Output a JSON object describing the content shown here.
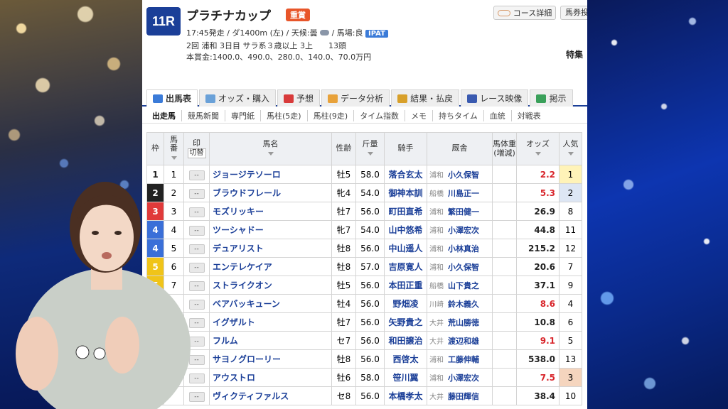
{
  "race": {
    "number": "11R",
    "name": "プラチナカップ",
    "grade": "重賞",
    "line1": "17:45発走 / ダ1400m (左) / 天候:曇",
    "line1_tail": "/ 馬場:良",
    "ipat": "IPAT",
    "line2": "2回 浦和 3日目 サラ系３歳以上 3上　　13頭",
    "line3": "本賞金:1400.0、490.0、280.0、140.0、70.0万円",
    "course_button": "コース詳細",
    "bet_button": "馬券投",
    "special": "特集"
  },
  "tabs": [
    {
      "label": "出馬表",
      "icon": "table-icon",
      "color": "#3b7bd8"
    },
    {
      "label": "オッズ・購入",
      "icon": "odds-icon",
      "color": "#6aa1d8"
    },
    {
      "label": "予想",
      "icon": "target-icon",
      "color": "#d83a3a"
    },
    {
      "label": "データ分析",
      "icon": "chart-icon",
      "color": "#e8a23a"
    },
    {
      "label": "結果・払戻",
      "icon": "coins-icon",
      "color": "#d8a02a"
    },
    {
      "label": "レース映像",
      "icon": "video-icon",
      "color": "#3a5ab0"
    },
    {
      "label": "掲示",
      "icon": "board-icon",
      "color": "#3aa05a"
    }
  ],
  "subtabs": [
    "出走馬",
    "競馬新聞",
    "専門紙",
    "馬柱(5走)",
    "馬柱(9走)",
    "タイム指数",
    "メモ",
    "持ちタイム",
    "血統",
    "対戦表"
  ],
  "table": {
    "headers": {
      "frame": "枠",
      "number_1": "馬",
      "number_2": "番",
      "mark": "印",
      "swap": "切替",
      "horse": "馬名",
      "sex_age": "性齢",
      "weight": "斤量",
      "jockey": "騎手",
      "trainer": "厩舎",
      "body_1": "馬体重",
      "body_2": "(増減)",
      "odds": "オッズ",
      "popularity_1": "人",
      "popularity_2": "気"
    },
    "mark_placeholder": "--",
    "rows": [
      {
        "frame": "1",
        "num": "1",
        "horse": "ジョージテソーロ",
        "sex_age": "牡5",
        "weight": "58.0",
        "jockey": "落合玄太",
        "region": "浦和",
        "trainer": "小久保智",
        "odds": "2.2",
        "hot": true,
        "pop": "1"
      },
      {
        "frame": "2",
        "num": "2",
        "horse": "ブラウドフレール",
        "sex_age": "牝4",
        "weight": "54.0",
        "jockey": "御神本訓",
        "region": "船橋",
        "trainer": "川島正一",
        "odds": "5.3",
        "hot": true,
        "pop": "2"
      },
      {
        "frame": "3",
        "num": "3",
        "horse": "モズリッキー",
        "sex_age": "牡7",
        "weight": "56.0",
        "jockey": "町田直希",
        "region": "浦和",
        "trainer": "繁田健一",
        "odds": "26.9",
        "hot": false,
        "pop": "8"
      },
      {
        "frame": "4",
        "num": "4",
        "horse": "ツーシャドー",
        "sex_age": "牝7",
        "weight": "54.0",
        "jockey": "山中悠希",
        "region": "浦和",
        "trainer": "小澤宏次",
        "odds": "44.8",
        "hot": false,
        "pop": "11"
      },
      {
        "frame": "4",
        "num": "5",
        "horse": "デュアリスト",
        "sex_age": "牡8",
        "weight": "56.0",
        "jockey": "中山遥人",
        "region": "浦和",
        "trainer": "小林真治",
        "odds": "215.2",
        "hot": false,
        "pop": "12"
      },
      {
        "frame": "5",
        "num": "6",
        "horse": "エンテレケイア",
        "sex_age": "牡8",
        "weight": "57.0",
        "jockey": "吉原寛人",
        "region": "浦和",
        "trainer": "小久保智",
        "odds": "20.6",
        "hot": false,
        "pop": "7"
      },
      {
        "frame": "5",
        "num": "7",
        "horse": "ストライクオン",
        "sex_age": "牡5",
        "weight": "56.0",
        "jockey": "本田正重",
        "region": "船橋",
        "trainer": "山下貴之",
        "odds": "37.1",
        "hot": false,
        "pop": "9"
      },
      {
        "frame": "",
        "num": "",
        "horse": "ベアバッキューン",
        "sex_age": "牡4",
        "weight": "56.0",
        "jockey": "野畑凌",
        "region": "川崎",
        "trainer": "鈴木義久",
        "odds": "8.6",
        "hot": true,
        "pop": "4"
      },
      {
        "frame": "",
        "num": "",
        "horse": "イグザルト",
        "sex_age": "牡7",
        "weight": "56.0",
        "jockey": "矢野貴之",
        "region": "大井",
        "trainer": "荒山勝徳",
        "odds": "10.8",
        "hot": false,
        "pop": "6"
      },
      {
        "frame": "",
        "num": "",
        "horse": "フルム",
        "sex_age": "セ7",
        "weight": "56.0",
        "jockey": "和田譲治",
        "region": "大井",
        "trainer": "渡辺和雄",
        "odds": "9.1",
        "hot": true,
        "pop": "5"
      },
      {
        "frame": "",
        "num": "",
        "horse": "サヨノグローリー",
        "sex_age": "牡8",
        "weight": "56.0",
        "jockey": "西啓太",
        "region": "浦和",
        "trainer": "工藤伸輔",
        "odds": "538.0",
        "hot": false,
        "pop": "13"
      },
      {
        "frame": "",
        "num": "",
        "horse": "アウストロ",
        "sex_age": "牡6",
        "weight": "58.0",
        "jockey": "笹川翼",
        "region": "浦和",
        "trainer": "小澤宏次",
        "odds": "7.5",
        "hot": true,
        "pop": "3"
      },
      {
        "frame": "",
        "num": "",
        "horse": "ヴィクティファルス",
        "sex_age": "セ8",
        "weight": "56.0",
        "jockey": "本橋孝太",
        "region": "大井",
        "trainer": "藤田輝信",
        "odds": "38.4",
        "hot": false,
        "pop": "10"
      }
    ]
  },
  "frame_colors": {
    "1": {
      "bg": "#ffffff",
      "fg": "#222222"
    },
    "2": {
      "bg": "#222222",
      "fg": "#ffffff"
    },
    "3": {
      "bg": "#e03a3a",
      "fg": "#ffffff"
    },
    "4": {
      "bg": "#3a6fd8",
      "fg": "#ffffff"
    },
    "5": {
      "bg": "#f0c419",
      "fg": "#ffffff"
    }
  },
  "streamer": {
    "icon": "webcam-person",
    "shirt_color": "#c9cfc8",
    "hair_color": "#4a2f22"
  }
}
